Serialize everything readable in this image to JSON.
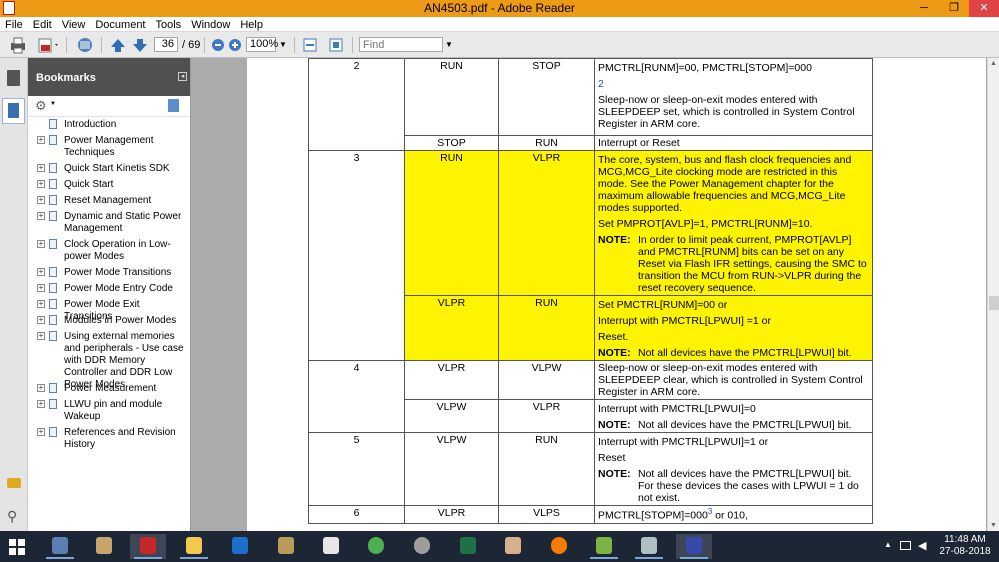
{
  "window": {
    "title": "AN4503.pdf - Adobe Reader",
    "min": "─",
    "max": "❐",
    "close": "✕"
  },
  "menu": [
    "File",
    "Edit",
    "View",
    "Document",
    "Tools",
    "Window",
    "Help"
  ],
  "toolbar": {
    "page_current": "36",
    "page_total": "/ 69",
    "zoom": "100%",
    "find_placeholder": "Find"
  },
  "bookmarks": {
    "header": "Bookmarks",
    "items": [
      {
        "label": "Introduction",
        "expand": false
      },
      {
        "label": "Power Management Techniques",
        "expand": true
      },
      {
        "label": "Quick Start Kinetis SDK",
        "expand": true
      },
      {
        "label": "Quick Start",
        "expand": true
      },
      {
        "label": "Reset Management",
        "expand": true
      },
      {
        "label": "Dynamic and Static Power Management",
        "expand": true
      },
      {
        "label": "Clock Operation in Low-power Modes",
        "expand": true
      },
      {
        "label": "Power Mode Transitions",
        "expand": true
      },
      {
        "label": "Power Mode Entry Code",
        "expand": true
      },
      {
        "label": "Power Mode Exit Transitions",
        "expand": true
      },
      {
        "label": "Modules in Power Modes",
        "expand": true
      },
      {
        "label": "Using external memories and peripherals - Use case with DDR Memory Controller and DDR Low Power Modes",
        "expand": true
      },
      {
        "label": "Power Measurement",
        "expand": true
      },
      {
        "label": "LLWU pin and module Wakeup",
        "expand": true
      },
      {
        "label": "References and Revision History",
        "expand": true
      }
    ]
  },
  "table": {
    "r2": {
      "num": "2",
      "from": "RUN",
      "to": "STOP",
      "line1": "PMCTRL[RUNM]=00, PMCTRL[STOPM]=000",
      "line2": "2",
      "line3": "Sleep-now or sleep-on-exit modes entered with SLEEPDEEP set, which is controlled in System Control Register in ARM core."
    },
    "r2b": {
      "from": "STOP",
      "to": "RUN",
      "text": "Interrupt or Reset"
    },
    "r3": {
      "num": "3",
      "from": "RUN",
      "to": "VLPR",
      "line1": "The core, system, bus and flash clock frequencies and MCG,MCG_Lite clocking mode are restricted in this mode. See the Power Management chapter for the maximum allowable frequencies and MCG,MCG_Lite modes supported.",
      "line2": "Set PMPROT[AVLP]=1, PMCTRL[RUNM]=10.",
      "note_label": "NOTE:",
      "note": "In order to limit peak current, PMPROT[AVLP] and PMCTRL[RUNM] bits can be set on any Reset via Flash IFR settings, causing the SMC to transition the MCU from RUN->VLPR during the reset recovery sequence."
    },
    "r3b": {
      "from": "VLPR",
      "to": "RUN",
      "line1": "Set PMCTRL[RUNM]=00 or",
      "line2": "Interrupt with PMCTRL[LPWUI] =1 or",
      "line3": "Reset.",
      "note_label": "NOTE:",
      "note": "Not all devices have the PMCTRL[LPWUI] bit."
    },
    "r4": {
      "num": "4",
      "from": "VLPR",
      "to": "VLPW",
      "text": "Sleep-now or sleep-on-exit modes entered with SLEEPDEEP clear, which is controlled in System Control Register in ARM core."
    },
    "r4b": {
      "from": "VLPW",
      "to": "VLPR",
      "line1": "Interrupt with PMCTRL[LPWUI]=0",
      "note_label": "NOTE:",
      "note": "Not all devices have the PMCTRL[LPWUI] bit."
    },
    "r5": {
      "num": "5",
      "from": "VLPW",
      "to": "RUN",
      "line1": "Interrupt with PMCTRL[LPWUI]=1 or",
      "line2": "Reset",
      "note_label": "NOTE:",
      "note": "Not all devices have the PMCTRL[LPWUI] bit. For these devices the cases with LPWUI = 1 do not exist."
    },
    "r6": {
      "num": "6",
      "from": "VLPR",
      "to": "VLPS",
      "line1": "PMCTRL[STOPM]=000",
      "sup": "3",
      "line1b": " or 010,"
    }
  },
  "taskbar": {
    "time": "11:48 AM",
    "date": "27-08-2018"
  },
  "colors": {
    "titlebar": "#ed9a17",
    "highlight": "#fff400",
    "taskbar": "#1d2635",
    "bookmark_header": "#505050"
  }
}
